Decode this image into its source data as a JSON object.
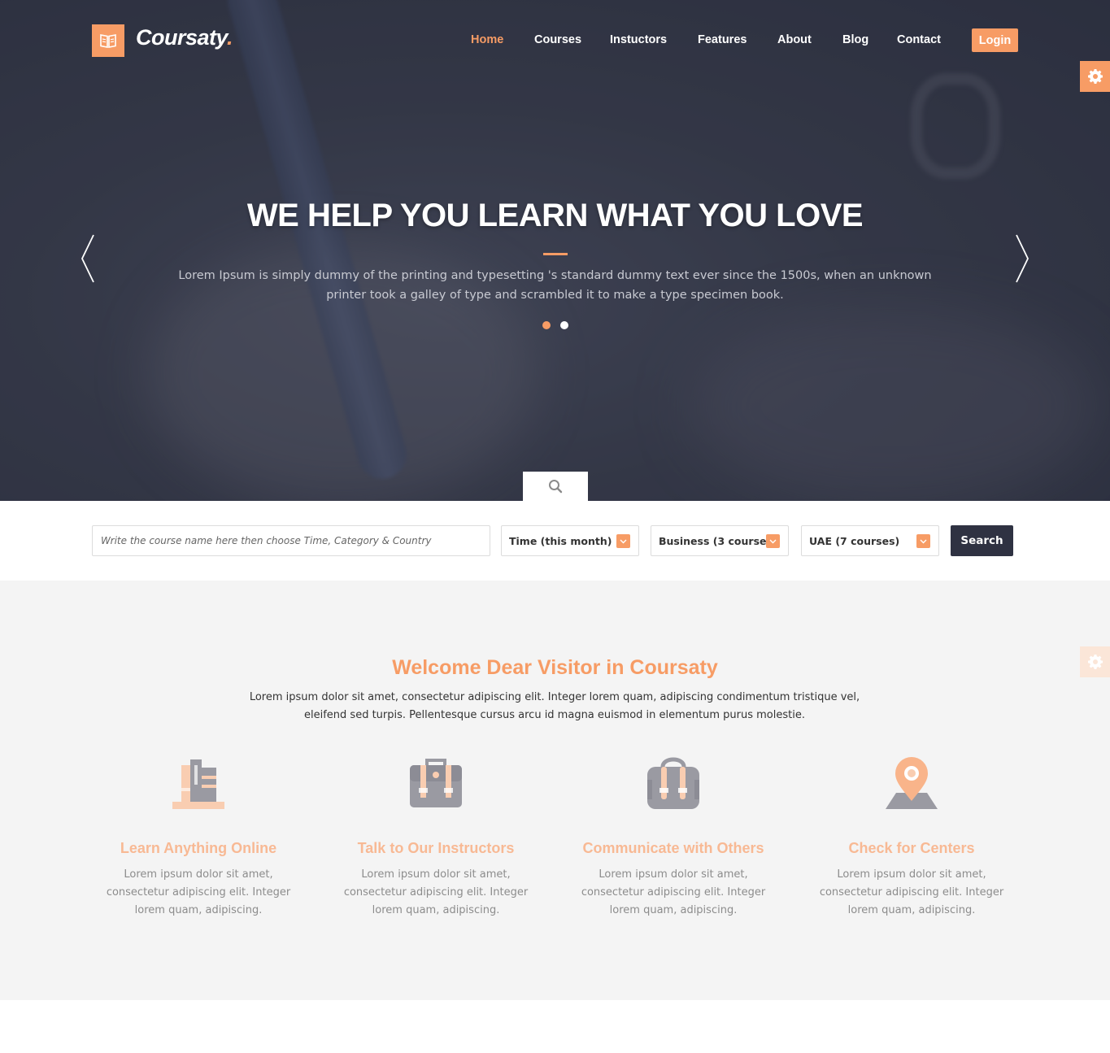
{
  "brand": {
    "name": "Coursaty",
    "dot": ".",
    "logo_icon": "book-icon",
    "accent": "#f79c65",
    "dark": "#2f3242"
  },
  "nav": {
    "items": [
      {
        "label": "Home",
        "active": true
      },
      {
        "label": "Courses",
        "active": false
      },
      {
        "label": "Instuctors",
        "active": false
      },
      {
        "label": "Features",
        "active": false
      },
      {
        "label": "About",
        "active": false
      },
      {
        "label": "Blog",
        "active": false
      },
      {
        "label": "Contact",
        "active": false
      }
    ],
    "login_label": "Login"
  },
  "settings_icon": "gear-icon",
  "hero": {
    "title": "WE HELP YOU LEARN WHAT YOU LOVE",
    "subtitle": "Lorem Ipsum is simply dummy of the printing and typesetting 's standard dummy text ever since the 1500s, when an unknown printer took a galley of type and scrambled it to make a type specimen book.",
    "slides": 2,
    "active_slide": 1,
    "prev_icon": "chevron-left-icon",
    "next_icon": "chevron-right-icon",
    "search_tab_icon": "search-icon"
  },
  "search": {
    "placeholder": "Write the course name here then choose Time, Category & Country",
    "time_select": "Time (this month)",
    "category_select": "Business (3 courses)",
    "country_select": "UAE (7 courses)",
    "button_label": "Search"
  },
  "welcome": {
    "title": "Welcome Dear Visitor in Coursaty",
    "text": "Lorem ipsum dolor sit amet, consectetur adipiscing elit. Integer lorem quam, adipiscing condimentum tristique vel, eleifend sed turpis. Pellentesque cursus arcu id magna euismod in elementum purus molestie.",
    "features": [
      {
        "icon": "books-icon",
        "title": "Learn Anything Online",
        "text": "Lorem ipsum dolor sit amet, consectetur adipiscing elit. Integer lorem quam, adipiscing."
      },
      {
        "icon": "briefcase-icon",
        "title": "Talk to Our Instructors",
        "text": "Lorem ipsum dolor sit amet, consectetur adipiscing elit. Integer lorem quam, adipiscing."
      },
      {
        "icon": "backpack-icon",
        "title": "Communicate with Others",
        "text": "Lorem ipsum dolor sit amet, consectetur adipiscing elit. Integer lorem quam, adipiscing."
      },
      {
        "icon": "map-pin-icon",
        "title": "Check for Centers",
        "text": "Lorem ipsum dolor sit amet, consectetur adipiscing elit. Integer lorem quam, adipiscing."
      }
    ]
  }
}
